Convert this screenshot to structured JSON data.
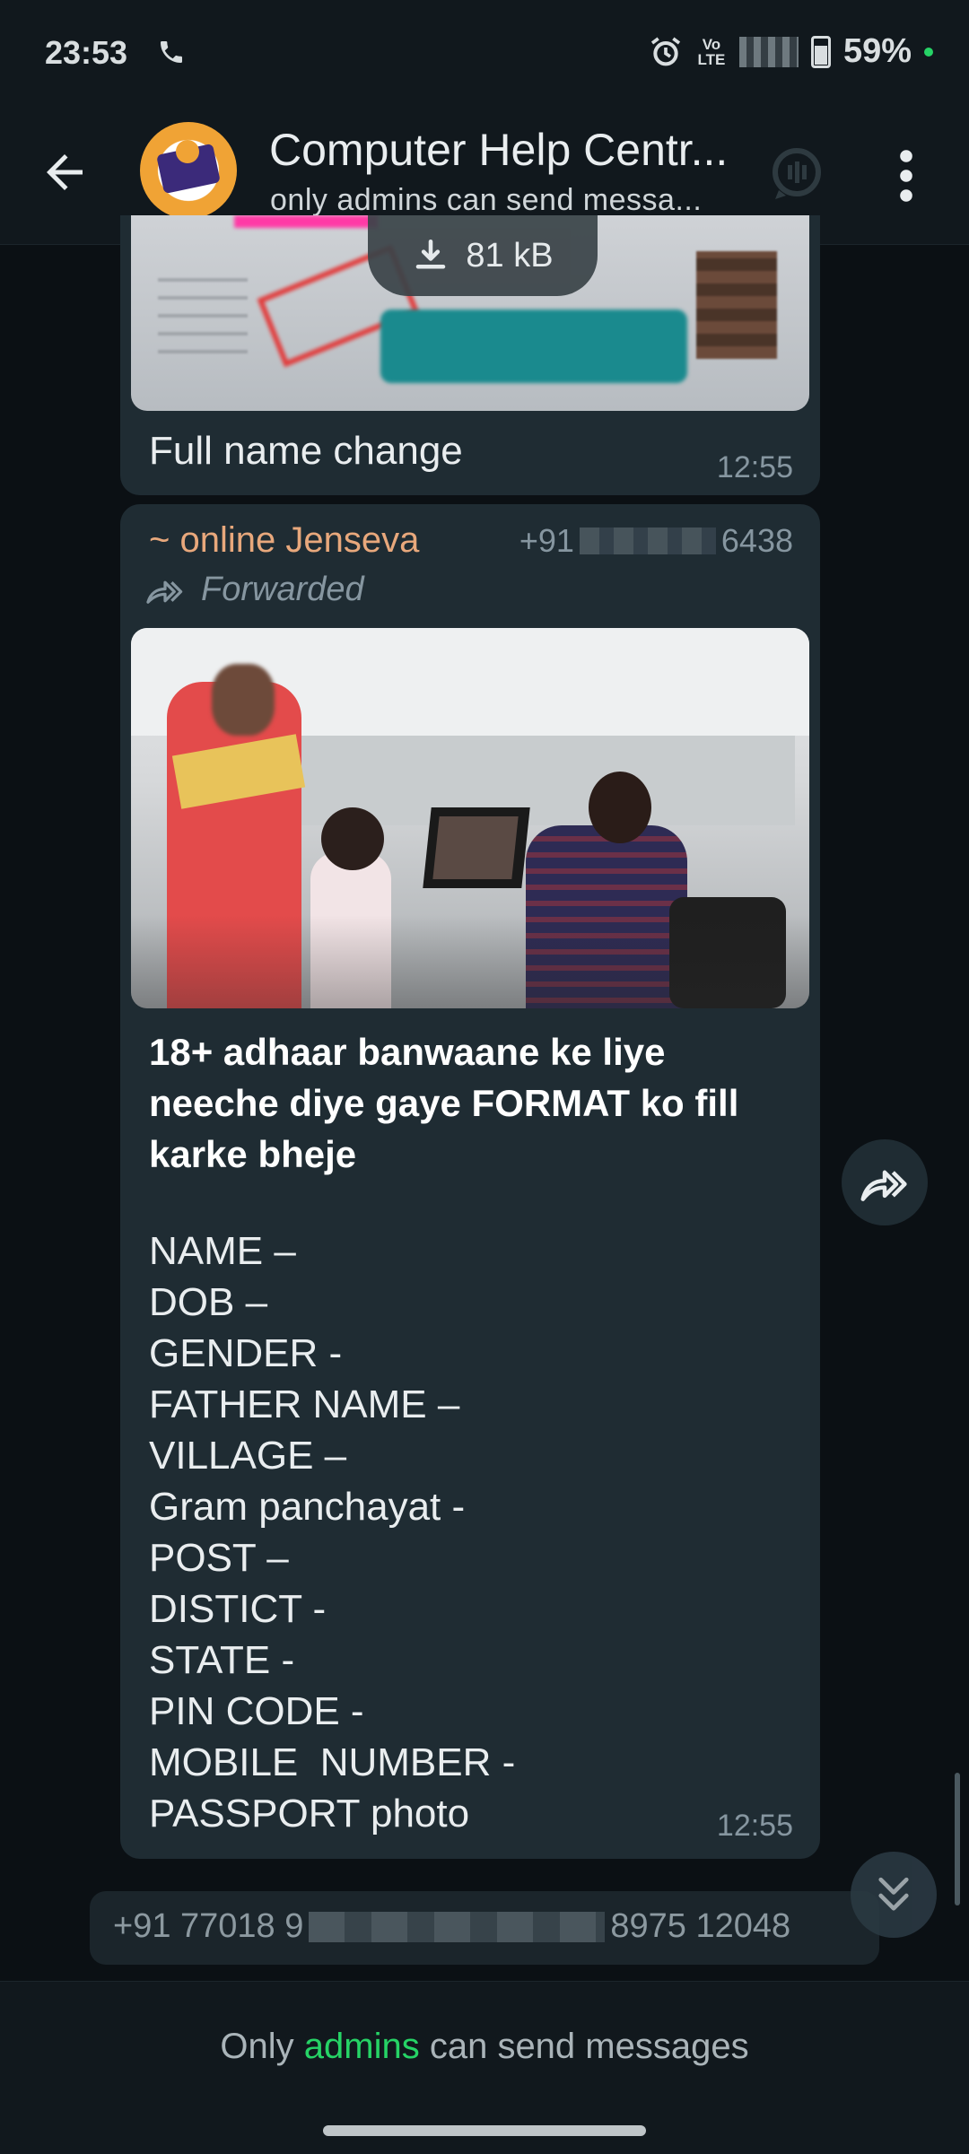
{
  "status_bar": {
    "time": "23:53",
    "volte_top": "Vo",
    "volte_bottom": "LTE",
    "battery": "59%"
  },
  "header": {
    "title": "Computer Help Centr...",
    "subtitle": "only admins can send messa..."
  },
  "messages": [
    {
      "download_size": "81 kB",
      "caption": "Full name change",
      "time": "12:55"
    },
    {
      "sender": "~ online Jenseva",
      "phone_prefix": "+91",
      "phone_suffix": "6438",
      "forwarded_label": "Forwarded",
      "headline": "18+ adhaar banwaane ke liye neeche diye gaye FORMAT ko fill karke bheje",
      "lines": [
        "NAME –",
        "DOB –",
        "GENDER -",
        "FATHER NAME –",
        "VILLAGE –",
        "Gram panchayat -",
        "POST –",
        "DISTICT -",
        "STATE -",
        "PIN CODE -",
        "MOBILE  NUMBER -",
        "PASSPORT photo"
      ],
      "time": "12:55"
    },
    {
      "text_start": "+91 77018 9",
      "text_end": "8975 12048"
    }
  ],
  "footer": {
    "prefix": "Only ",
    "link": "admins",
    "suffix": " can send messages"
  },
  "colors": {
    "accent": "#26d366",
    "sender": "#e8a87c",
    "bubble": "#1f2c33",
    "background": "#0b1014"
  },
  "icons": [
    "phone-icon",
    "alarm-icon",
    "back-arrow-icon",
    "voice-chat-icon",
    "more-vert-icon",
    "download-icon",
    "forward-icon",
    "scroll-down-icon"
  ]
}
